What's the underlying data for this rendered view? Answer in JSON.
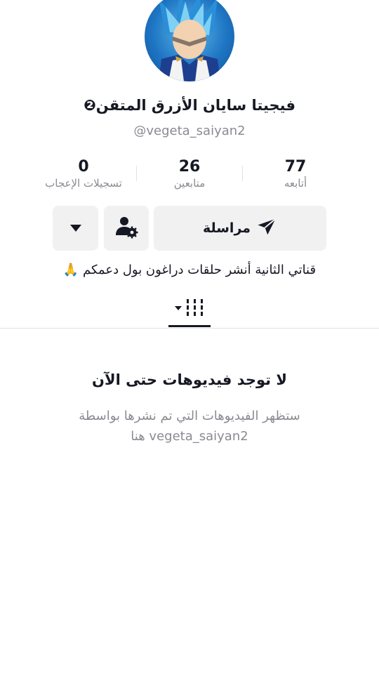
{
  "profile": {
    "display_name": "فيجيتا سايان الأزرق المتقن",
    "name_badge": "❷",
    "handle": "@vegeta_saiyan2",
    "bio": "قناتي الثانية أنشر حلقات دراغون بول دعمكم 🙏"
  },
  "stats": [
    {
      "value": "77",
      "label": "أتابعه"
    },
    {
      "value": "26",
      "label": "متابعين"
    },
    {
      "value": "0",
      "label": "تسجيلات الإعجاب"
    }
  ],
  "actions": {
    "message_label": "مراسلة",
    "message_icon": "send-icon",
    "settings_icon": "user-settings-icon",
    "more_icon": "caret-down-icon"
  },
  "tabs": {
    "videos_icon": "grid-bars-icon"
  },
  "empty_state": {
    "title": "لا توجد فيديوهات حتى الآن",
    "description": "ستظهر الفيديوهات التي تم نشرها بواسطة vegeta_saiyan2 هنا"
  }
}
